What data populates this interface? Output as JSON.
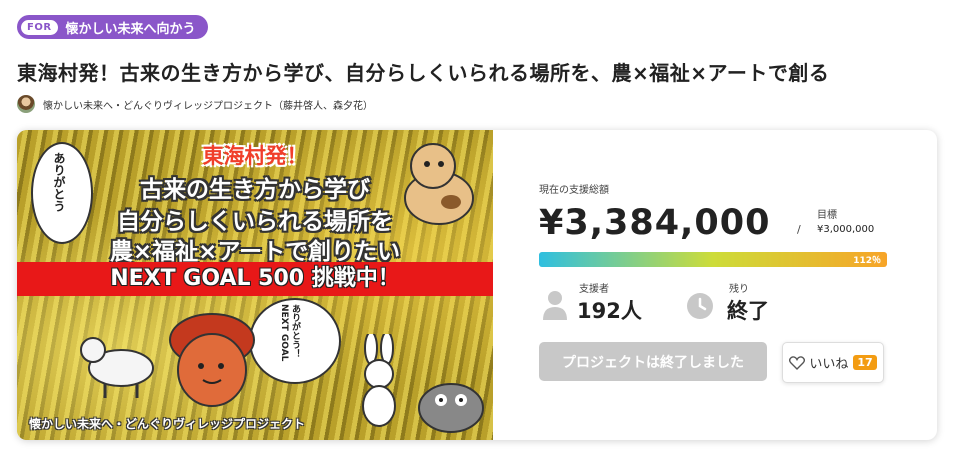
{
  "category": {
    "tag": "FOR",
    "label": "懐かしい未来へ向かう"
  },
  "project": {
    "title": "東海村発！古来の生き方から学び、自分らしくいられる場所を、農×福祉×アートで創る",
    "owner": "懐かしい未来へ・どんぐりヴィレッジプロジェクト（藤井啓人、森夕花）"
  },
  "hero": {
    "line1": "東海村発！",
    "line2": "古来の生き方から学び",
    "line3": "自分らしくいられる場所を",
    "line4": "農×福祉×アートで創りたい",
    "banner": "NEXT GOAL 500 挑戦中！",
    "footer": "懐かしい未来へ・どんぐりヴィレッジプロジェクト",
    "bubble_left": "ありがとう",
    "bubble_right": "ありがとう！NEXT GOAL"
  },
  "stats": {
    "total_label": "現在の支援総額",
    "total_amount": "¥3,384,000",
    "goal_label": "目標",
    "goal_amount": "¥3,000,000",
    "progress_percent": 112,
    "progress_text": "112％",
    "supporters_label": "支援者",
    "supporters_value": "192人",
    "remaining_label": "残り",
    "remaining_value": "終了"
  },
  "actions": {
    "ended_label": "プロジェクトは終了しました",
    "like_label": "いいね",
    "like_count": "17"
  },
  "colors": {
    "accent_purple": "#8a56c9",
    "like_badge": "#f39c12",
    "banner_red": "#e81818"
  }
}
